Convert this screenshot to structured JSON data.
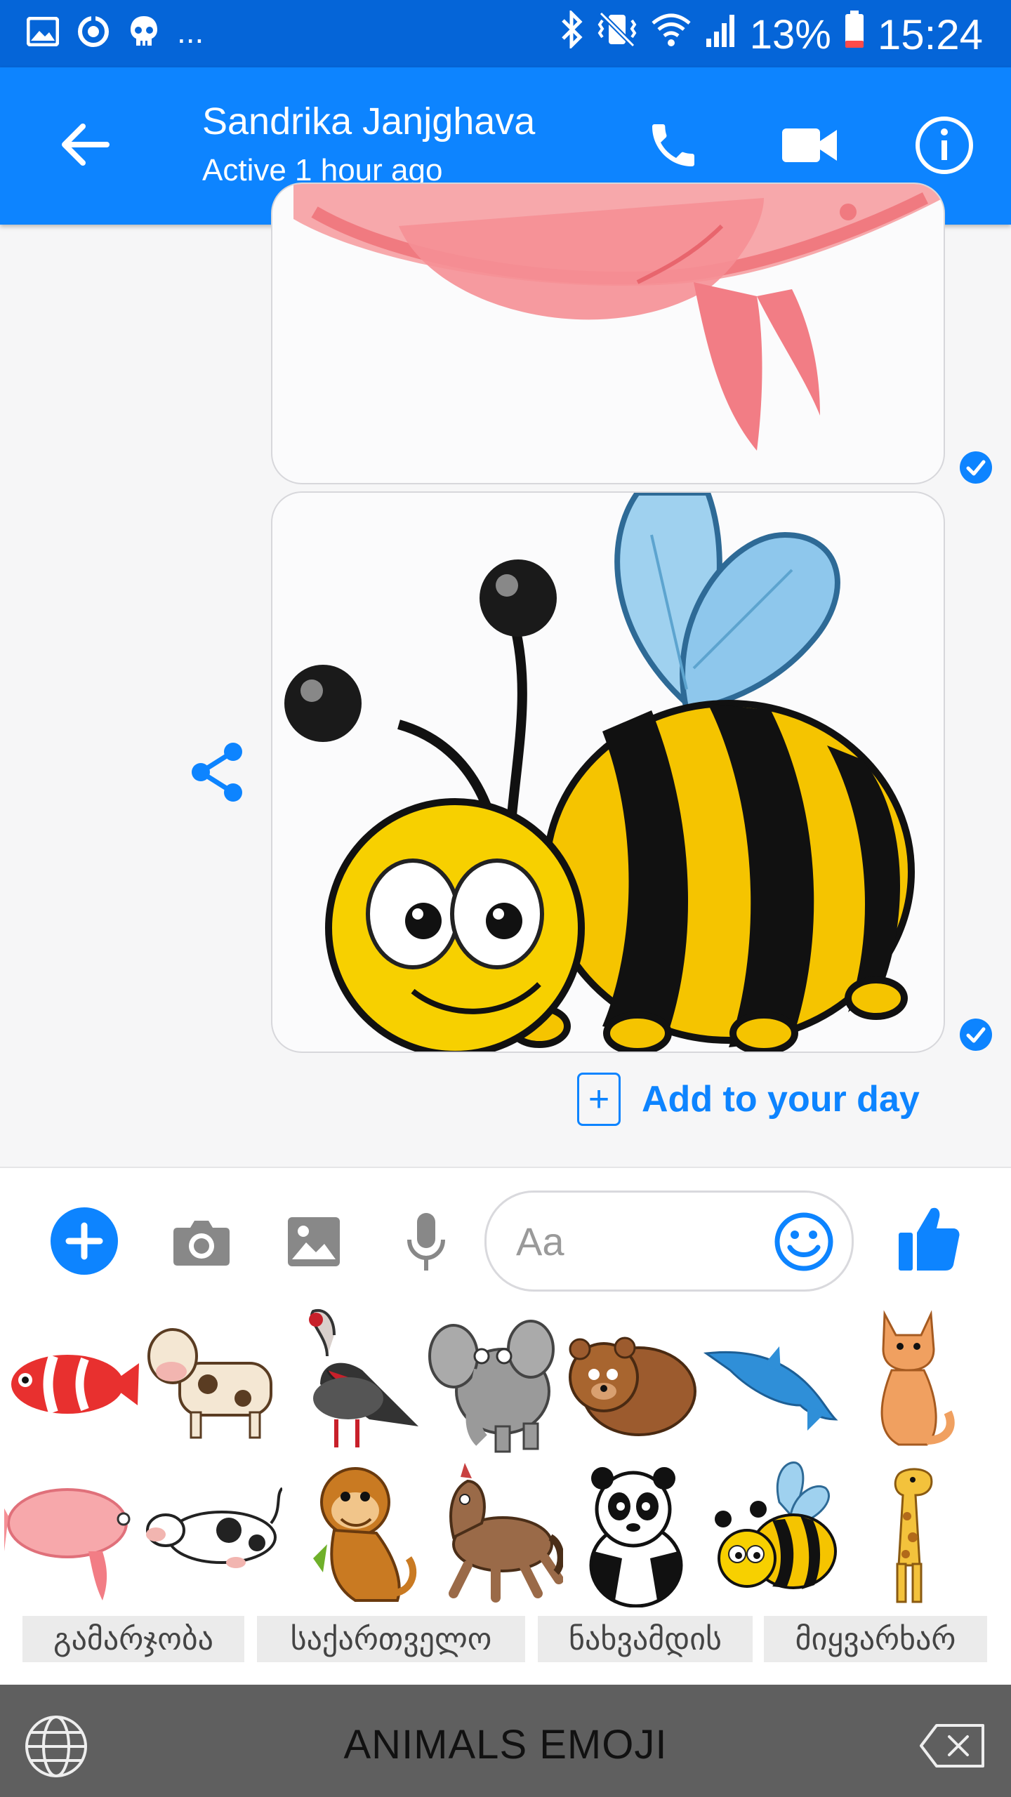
{
  "status_bar": {
    "battery": "13%",
    "time": "15:24",
    "overflow": "...",
    "left_icons": [
      "gallery-icon",
      "sync-icon",
      "skull-icon"
    ],
    "right_icons": [
      "bluetooth-icon",
      "vibrate-icon",
      "wifi-icon",
      "signal-icon",
      "battery-icon"
    ]
  },
  "header": {
    "contact_name": "Sandrika Janjghava",
    "contact_status": "Active 1 hour ago",
    "icons": [
      "back-arrow-icon",
      "phone-icon",
      "video-camera-icon",
      "info-icon"
    ]
  },
  "chat": {
    "messages": [
      {
        "type": "sticker",
        "sticker": "pink-fish",
        "status": "seen"
      },
      {
        "type": "sticker",
        "sticker": "bee",
        "status": "seen"
      }
    ],
    "add_to_day": "Add to your day"
  },
  "composer": {
    "placeholder": "Aa",
    "icons": [
      "plus-icon",
      "camera-icon",
      "image-icon",
      "microphone-icon",
      "emoji-icon",
      "thumbs-up-icon"
    ]
  },
  "keyboard": {
    "stickers_row1": [
      "clownfish",
      "cow",
      "turkey",
      "elephant",
      "bear",
      "dolphin",
      "cat"
    ],
    "stickers_row2": [
      "pink-fish",
      "lying-cow",
      "monkey",
      "horse",
      "panda",
      "bee",
      "giraffe"
    ],
    "suggestions": [
      "გამარჯობა",
      "საქართველო",
      "ნახვამდის",
      "მიყვარხარ"
    ],
    "title": "ANIMALS EMOJI"
  },
  "colors": {
    "status_bar": "#0565d8",
    "header": "#0d84ff",
    "accent": "#0d84ff",
    "keyboard_bar": "#5f5f5f"
  }
}
